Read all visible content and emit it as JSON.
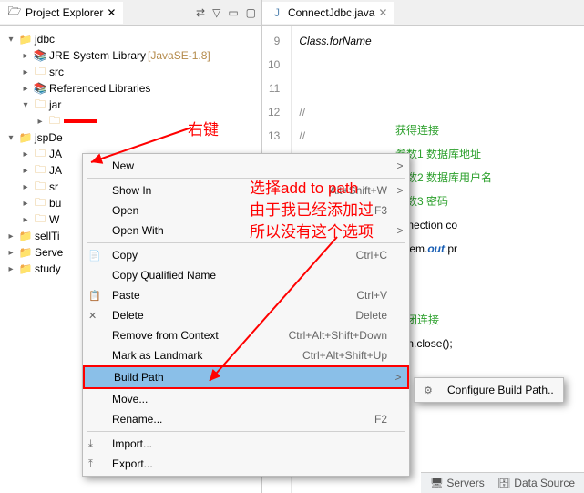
{
  "project_explorer": {
    "title": "Project Explorer",
    "items": [
      {
        "label": "jdbc",
        "depth": 0,
        "exp": "v",
        "icon": "proj"
      },
      {
        "label": "JRE System Library",
        "decor": "[JavaSE-1.8]",
        "depth": 1,
        "exp": ">",
        "icon": "lib"
      },
      {
        "label": "src",
        "depth": 1,
        "exp": ">",
        "icon": "folder"
      },
      {
        "label": "Referenced Libraries",
        "depth": 1,
        "exp": ">",
        "icon": "lib"
      },
      {
        "label": "jar",
        "depth": 1,
        "exp": "v",
        "icon": "folder"
      },
      {
        "label": "",
        "depth": 2,
        "exp": ">",
        "icon": "folder",
        "selected": true
      },
      {
        "label": "jspDe",
        "depth": 0,
        "exp": "v",
        "icon": "proj"
      },
      {
        "label": "JA",
        "depth": 1,
        "exp": ">",
        "icon": "folder"
      },
      {
        "label": "JA",
        "depth": 1,
        "exp": ">",
        "icon": "folder"
      },
      {
        "label": "sr",
        "depth": 1,
        "exp": ">",
        "icon": "folder"
      },
      {
        "label": "bu",
        "depth": 1,
        "exp": ">",
        "icon": "folder"
      },
      {
        "label": "W",
        "depth": 1,
        "exp": ">",
        "icon": "folder"
      },
      {
        "label": "sellTi",
        "depth": 0,
        "exp": ">",
        "icon": "proj"
      },
      {
        "label": "Serve",
        "depth": 0,
        "exp": ">",
        "icon": "proj"
      },
      {
        "label": "study",
        "depth": 0,
        "exp": ">",
        "icon": "proj"
      }
    ]
  },
  "editor": {
    "tab": "ConnectJdbc.java",
    "lines": [
      "9",
      "10",
      "11",
      "12",
      "13"
    ],
    "code": {
      "l9": {
        "pre": "Class.",
        "call": "forName"
      },
      "l12": "//",
      "l13": "//",
      "cmt1": "获得连接",
      "cmt2": "参数1  数据库地址",
      "cmt3": "参数2 数据库用户名",
      "cmt4": "参数3 密码",
      "conn": "onnection co",
      "sysout_a": "ystem.",
      "sysout_b": "out",
      "sysout_c": ".pr",
      "close_cmt": "关闭连接",
      "close": "onn.close();"
    }
  },
  "context_menu": [
    {
      "type": "item",
      "icon": "",
      "label": "New",
      "accel": "",
      "arrow": ">"
    },
    {
      "type": "sep"
    },
    {
      "type": "item",
      "icon": "",
      "label": "Show In",
      "accel": "Alt+Shift+W",
      "arrow": ">"
    },
    {
      "type": "item",
      "icon": "",
      "label": "Open",
      "accel": "F3",
      "arrow": ""
    },
    {
      "type": "item",
      "icon": "",
      "label": "Open With",
      "accel": "",
      "arrow": ">"
    },
    {
      "type": "sep"
    },
    {
      "type": "item",
      "icon": "📄",
      "label": "Copy",
      "accel": "Ctrl+C",
      "arrow": ""
    },
    {
      "type": "item",
      "icon": "",
      "label": "Copy Qualified Name",
      "accel": "",
      "arrow": ""
    },
    {
      "type": "item",
      "icon": "📋",
      "label": "Paste",
      "accel": "Ctrl+V",
      "arrow": ""
    },
    {
      "type": "item",
      "icon": "✕",
      "label": "Delete",
      "accel": "Delete",
      "arrow": ""
    },
    {
      "type": "item",
      "icon": "",
      "label": "Remove from Context",
      "accel": "Ctrl+Alt+Shift+Down",
      "arrow": ""
    },
    {
      "type": "item",
      "icon": "",
      "label": "Mark as Landmark",
      "accel": "Ctrl+Alt+Shift+Up",
      "arrow": ""
    },
    {
      "type": "item",
      "icon": "",
      "label": "Build Path",
      "accel": "",
      "arrow": ">",
      "hi": true
    },
    {
      "type": "item",
      "icon": "",
      "label": "Move...",
      "accel": "",
      "arrow": ""
    },
    {
      "type": "item",
      "icon": "",
      "label": "Rename...",
      "accel": "F2",
      "arrow": ""
    },
    {
      "type": "sep"
    },
    {
      "type": "item",
      "icon": "⤓",
      "label": "Import...",
      "accel": "",
      "arrow": ""
    },
    {
      "type": "item",
      "icon": "⤒",
      "label": "Export...",
      "accel": "",
      "arrow": ""
    }
  ],
  "submenu": {
    "label": "Configure Build Path.."
  },
  "annotations": {
    "rightclick": "右键",
    "line1": "选择add to path",
    "line2": "由于我已经添加过",
    "line3": "所以没有这个选项"
  },
  "status": {
    "servers": "Servers",
    "ds": "Data Source"
  }
}
